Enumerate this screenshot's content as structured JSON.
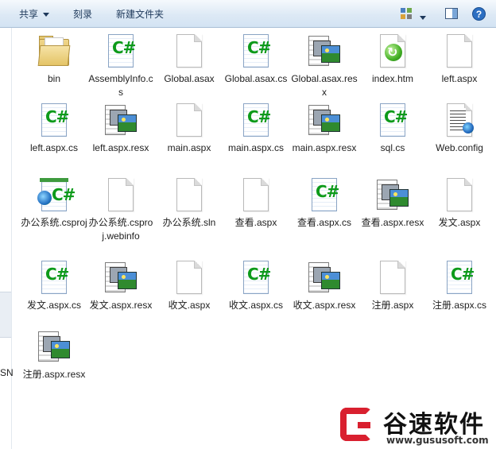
{
  "toolbar": {
    "share_label": "共享",
    "burn_label": "刻录",
    "new_folder_label": "新建文件夹",
    "view_icon": "view-options-icon",
    "preview_pane_icon": "preview-pane-icon",
    "help_icon": "help-icon"
  },
  "left_pane": {
    "truncated_text": "SN"
  },
  "files": [
    {
      "name": "bin",
      "type": "folder"
    },
    {
      "name": "AssemblyInfo.cs",
      "type": "cs"
    },
    {
      "name": "Global.asax",
      "type": "blank"
    },
    {
      "name": "Global.asax.cs",
      "type": "cs"
    },
    {
      "name": "Global.asax.resx",
      "type": "resx"
    },
    {
      "name": "index.htm",
      "type": "htm"
    },
    {
      "name": "left.aspx",
      "type": "blank"
    },
    {
      "name": "left.aspx.cs",
      "type": "cs"
    },
    {
      "name": "left.aspx.resx",
      "type": "resx"
    },
    {
      "name": "main.aspx",
      "type": "blank"
    },
    {
      "name": "main.aspx.cs",
      "type": "cs"
    },
    {
      "name": "main.aspx.resx",
      "type": "resx"
    },
    {
      "name": "sql.cs",
      "type": "cs"
    },
    {
      "name": "Web.config",
      "type": "config"
    },
    {
      "name": "办公系统.csproj",
      "type": "csproj"
    },
    {
      "name": "办公系统.csproj.webinfo",
      "type": "blank"
    },
    {
      "name": "办公系统.sln",
      "type": "blank"
    },
    {
      "name": "查看.aspx",
      "type": "blank"
    },
    {
      "name": "查看.aspx.cs",
      "type": "cs"
    },
    {
      "name": "查看.aspx.resx",
      "type": "resx"
    },
    {
      "name": "发文.aspx",
      "type": "blank"
    },
    {
      "name": "发文.aspx.cs",
      "type": "cs"
    },
    {
      "name": "发文.aspx.resx",
      "type": "resx"
    },
    {
      "name": "收文.aspx",
      "type": "blank"
    },
    {
      "name": "收文.aspx.cs",
      "type": "cs"
    },
    {
      "name": "收文.aspx.resx",
      "type": "resx"
    },
    {
      "name": "注册.aspx",
      "type": "blank"
    },
    {
      "name": "注册.aspx.cs",
      "type": "cs"
    },
    {
      "name": "注册.aspx.resx",
      "type": "resx"
    }
  ],
  "watermark": {
    "brand": "谷速软件",
    "url": "www.gususoft.com"
  },
  "colors": {
    "toolbar_text": "#1e395b",
    "cs_green": "#0d9a1a",
    "watermark_red": "#d9202f"
  }
}
